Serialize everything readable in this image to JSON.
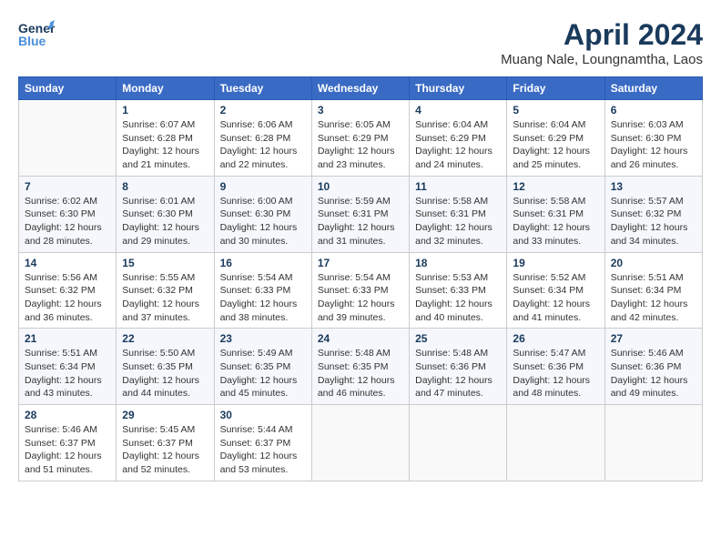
{
  "header": {
    "logo_general": "General",
    "logo_blue": "Blue",
    "main_title": "April 2024",
    "subtitle": "Muang Nale, Loungnamtha, Laos"
  },
  "weekdays": [
    "Sunday",
    "Monday",
    "Tuesday",
    "Wednesday",
    "Thursday",
    "Friday",
    "Saturday"
  ],
  "weeks": [
    [
      {
        "day": "",
        "sunrise": "",
        "sunset": "",
        "daylight": ""
      },
      {
        "day": "1",
        "sunrise": "Sunrise: 6:07 AM",
        "sunset": "Sunset: 6:28 PM",
        "daylight": "Daylight: 12 hours and 21 minutes."
      },
      {
        "day": "2",
        "sunrise": "Sunrise: 6:06 AM",
        "sunset": "Sunset: 6:28 PM",
        "daylight": "Daylight: 12 hours and 22 minutes."
      },
      {
        "day": "3",
        "sunrise": "Sunrise: 6:05 AM",
        "sunset": "Sunset: 6:29 PM",
        "daylight": "Daylight: 12 hours and 23 minutes."
      },
      {
        "day": "4",
        "sunrise": "Sunrise: 6:04 AM",
        "sunset": "Sunset: 6:29 PM",
        "daylight": "Daylight: 12 hours and 24 minutes."
      },
      {
        "day": "5",
        "sunrise": "Sunrise: 6:04 AM",
        "sunset": "Sunset: 6:29 PM",
        "daylight": "Daylight: 12 hours and 25 minutes."
      },
      {
        "day": "6",
        "sunrise": "Sunrise: 6:03 AM",
        "sunset": "Sunset: 6:30 PM",
        "daylight": "Daylight: 12 hours and 26 minutes."
      }
    ],
    [
      {
        "day": "7",
        "sunrise": "Sunrise: 6:02 AM",
        "sunset": "Sunset: 6:30 PM",
        "daylight": "Daylight: 12 hours and 28 minutes."
      },
      {
        "day": "8",
        "sunrise": "Sunrise: 6:01 AM",
        "sunset": "Sunset: 6:30 PM",
        "daylight": "Daylight: 12 hours and 29 minutes."
      },
      {
        "day": "9",
        "sunrise": "Sunrise: 6:00 AM",
        "sunset": "Sunset: 6:30 PM",
        "daylight": "Daylight: 12 hours and 30 minutes."
      },
      {
        "day": "10",
        "sunrise": "Sunrise: 5:59 AM",
        "sunset": "Sunset: 6:31 PM",
        "daylight": "Daylight: 12 hours and 31 minutes."
      },
      {
        "day": "11",
        "sunrise": "Sunrise: 5:58 AM",
        "sunset": "Sunset: 6:31 PM",
        "daylight": "Daylight: 12 hours and 32 minutes."
      },
      {
        "day": "12",
        "sunrise": "Sunrise: 5:58 AM",
        "sunset": "Sunset: 6:31 PM",
        "daylight": "Daylight: 12 hours and 33 minutes."
      },
      {
        "day": "13",
        "sunrise": "Sunrise: 5:57 AM",
        "sunset": "Sunset: 6:32 PM",
        "daylight": "Daylight: 12 hours and 34 minutes."
      }
    ],
    [
      {
        "day": "14",
        "sunrise": "Sunrise: 5:56 AM",
        "sunset": "Sunset: 6:32 PM",
        "daylight": "Daylight: 12 hours and 36 minutes."
      },
      {
        "day": "15",
        "sunrise": "Sunrise: 5:55 AM",
        "sunset": "Sunset: 6:32 PM",
        "daylight": "Daylight: 12 hours and 37 minutes."
      },
      {
        "day": "16",
        "sunrise": "Sunrise: 5:54 AM",
        "sunset": "Sunset: 6:33 PM",
        "daylight": "Daylight: 12 hours and 38 minutes."
      },
      {
        "day": "17",
        "sunrise": "Sunrise: 5:54 AM",
        "sunset": "Sunset: 6:33 PM",
        "daylight": "Daylight: 12 hours and 39 minutes."
      },
      {
        "day": "18",
        "sunrise": "Sunrise: 5:53 AM",
        "sunset": "Sunset: 6:33 PM",
        "daylight": "Daylight: 12 hours and 40 minutes."
      },
      {
        "day": "19",
        "sunrise": "Sunrise: 5:52 AM",
        "sunset": "Sunset: 6:34 PM",
        "daylight": "Daylight: 12 hours and 41 minutes."
      },
      {
        "day": "20",
        "sunrise": "Sunrise: 5:51 AM",
        "sunset": "Sunset: 6:34 PM",
        "daylight": "Daylight: 12 hours and 42 minutes."
      }
    ],
    [
      {
        "day": "21",
        "sunrise": "Sunrise: 5:51 AM",
        "sunset": "Sunset: 6:34 PM",
        "daylight": "Daylight: 12 hours and 43 minutes."
      },
      {
        "day": "22",
        "sunrise": "Sunrise: 5:50 AM",
        "sunset": "Sunset: 6:35 PM",
        "daylight": "Daylight: 12 hours and 44 minutes."
      },
      {
        "day": "23",
        "sunrise": "Sunrise: 5:49 AM",
        "sunset": "Sunset: 6:35 PM",
        "daylight": "Daylight: 12 hours and 45 minutes."
      },
      {
        "day": "24",
        "sunrise": "Sunrise: 5:48 AM",
        "sunset": "Sunset: 6:35 PM",
        "daylight": "Daylight: 12 hours and 46 minutes."
      },
      {
        "day": "25",
        "sunrise": "Sunrise: 5:48 AM",
        "sunset": "Sunset: 6:36 PM",
        "daylight": "Daylight: 12 hours and 47 minutes."
      },
      {
        "day": "26",
        "sunrise": "Sunrise: 5:47 AM",
        "sunset": "Sunset: 6:36 PM",
        "daylight": "Daylight: 12 hours and 48 minutes."
      },
      {
        "day": "27",
        "sunrise": "Sunrise: 5:46 AM",
        "sunset": "Sunset: 6:36 PM",
        "daylight": "Daylight: 12 hours and 49 minutes."
      }
    ],
    [
      {
        "day": "28",
        "sunrise": "Sunrise: 5:46 AM",
        "sunset": "Sunset: 6:37 PM",
        "daylight": "Daylight: 12 hours and 51 minutes."
      },
      {
        "day": "29",
        "sunrise": "Sunrise: 5:45 AM",
        "sunset": "Sunset: 6:37 PM",
        "daylight": "Daylight: 12 hours and 52 minutes."
      },
      {
        "day": "30",
        "sunrise": "Sunrise: 5:44 AM",
        "sunset": "Sunset: 6:37 PM",
        "daylight": "Daylight: 12 hours and 53 minutes."
      },
      {
        "day": "",
        "sunrise": "",
        "sunset": "",
        "daylight": ""
      },
      {
        "day": "",
        "sunrise": "",
        "sunset": "",
        "daylight": ""
      },
      {
        "day": "",
        "sunrise": "",
        "sunset": "",
        "daylight": ""
      },
      {
        "day": "",
        "sunrise": "",
        "sunset": "",
        "daylight": ""
      }
    ]
  ]
}
